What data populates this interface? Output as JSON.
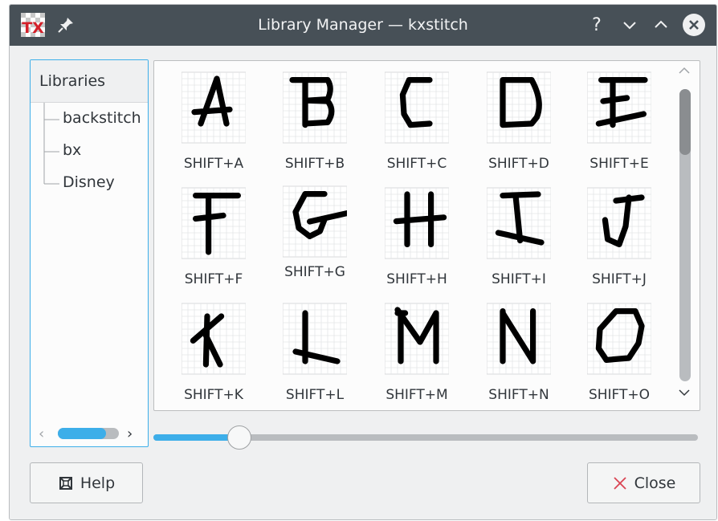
{
  "window": {
    "title": "Library Manager — kxstitch",
    "app_icon_text": "TX"
  },
  "titlebar_buttons": {
    "help": "?",
    "minimize": "⌵",
    "maximize": "⌃",
    "close": "✕"
  },
  "tree": {
    "header": "Libraries",
    "items": [
      {
        "label": "backstitch"
      },
      {
        "label": "bx"
      },
      {
        "label": "Disney"
      }
    ]
  },
  "grid": {
    "items": [
      {
        "char": "A",
        "label": "SHIFT+A"
      },
      {
        "char": "B",
        "label": "SHIFT+B"
      },
      {
        "char": "C",
        "label": "SHIFT+C"
      },
      {
        "char": "D",
        "label": "SHIFT+D"
      },
      {
        "char": "E",
        "label": "SHIFT+E"
      },
      {
        "char": "F",
        "label": "SHIFT+F"
      },
      {
        "char": "G",
        "label": "SHIFT+G"
      },
      {
        "char": "H",
        "label": "SHIFT+H"
      },
      {
        "char": "I",
        "label": "SHIFT+I"
      },
      {
        "char": "J",
        "label": "SHIFT+J"
      },
      {
        "char": "K",
        "label": "SHIFT+K"
      },
      {
        "char": "L",
        "label": "SHIFT+L"
      },
      {
        "char": "M",
        "label": "SHIFT+M"
      },
      {
        "char": "N",
        "label": "SHIFT+N"
      },
      {
        "char": "O",
        "label": "SHIFT+O"
      }
    ]
  },
  "zoom_slider": {
    "value_fraction": 0.15
  },
  "buttons": {
    "help": "Help",
    "close": "Close"
  },
  "colors": {
    "accent": "#3daee9",
    "titlebar": "#475057",
    "close_icon": "#da4453"
  },
  "icons": {
    "help_button": "lifebuoy-icon",
    "close_button": "x-icon",
    "pin": "pin-icon"
  }
}
